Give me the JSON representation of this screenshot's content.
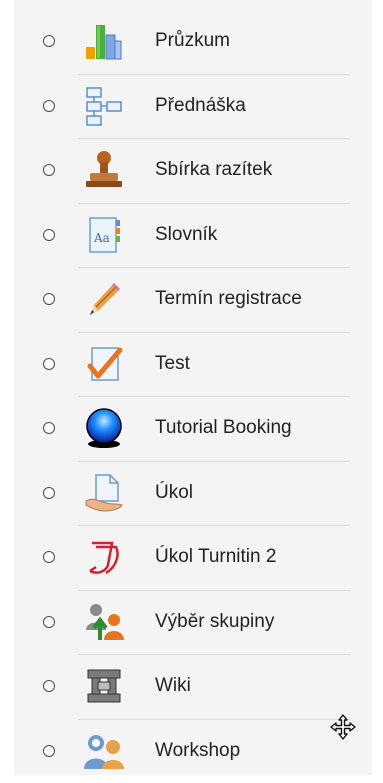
{
  "activities": [
    {
      "label": "Průzkum",
      "icon": "survey-chart-icon"
    },
    {
      "label": "Přednáška",
      "icon": "lesson-flow-icon"
    },
    {
      "label": "Sbírka razítek",
      "icon": "stamp-icon"
    },
    {
      "label": "Slovník",
      "icon": "glossary-icon"
    },
    {
      "label": "Termín registrace",
      "icon": "pencil-icon"
    },
    {
      "label": "Test",
      "icon": "quiz-check-icon"
    },
    {
      "label": "Tutorial Booking",
      "icon": "blue-sphere-icon"
    },
    {
      "label": "Úkol",
      "icon": "assignment-hand-icon"
    },
    {
      "label": "Úkol Turnitin 2",
      "icon": "turnitin-icon"
    },
    {
      "label": "Výběr skupiny",
      "icon": "group-choice-icon"
    },
    {
      "label": "Wiki",
      "icon": "wiki-icon"
    },
    {
      "label": "Workshop",
      "icon": "workshop-people-icon"
    }
  ]
}
